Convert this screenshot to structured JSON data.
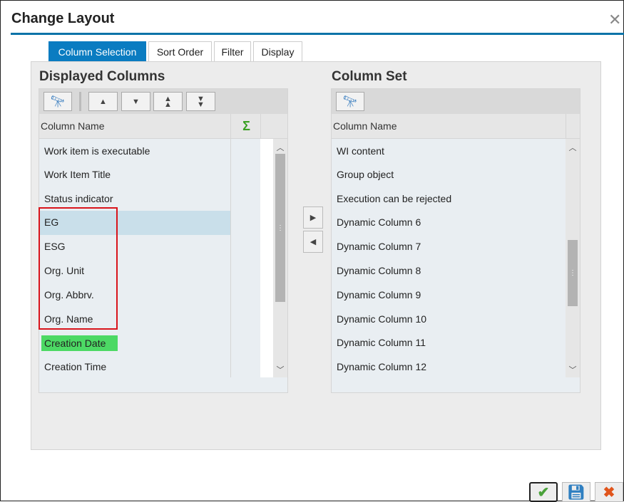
{
  "dialog": {
    "title": "Change Layout",
    "close_icon": "close-icon"
  },
  "tabs": [
    {
      "label": "Column Selection",
      "active": true
    },
    {
      "label": "Sort Order"
    },
    {
      "label": "Filter"
    },
    {
      "label": "Display"
    }
  ],
  "displayed": {
    "title": "Displayed Columns",
    "column_header": "Column Name",
    "sum_icon": "sigma-icon",
    "rows": [
      "Work item is executable",
      "Work Item Title",
      "Status indicator",
      "EG",
      "ESG",
      "Org. Unit",
      "Org. Abbrv.",
      "Org. Name",
      "Creation Date",
      "Creation Time"
    ],
    "selected_row": "EG",
    "highlighted_row": "Creation Date",
    "highlight_color": "#4cd964",
    "outlined_rows": [
      "EG",
      "ESG",
      "Org. Unit",
      "Org. Abbrv.",
      "Org. Name"
    ],
    "outline_color": "#d9141b"
  },
  "column_set": {
    "title": "Column Set",
    "column_header": "Column Name",
    "rows": [
      "WI content",
      "Group object",
      "Execution can be rejected",
      "Dynamic Column 6",
      "Dynamic Column 7",
      "Dynamic Column 8",
      "Dynamic Column 9",
      "Dynamic Column 10",
      "Dynamic Column 11",
      "Dynamic Column 12"
    ]
  },
  "colors": {
    "accent": "#0a7cc1",
    "selected": "#c9dfea"
  }
}
